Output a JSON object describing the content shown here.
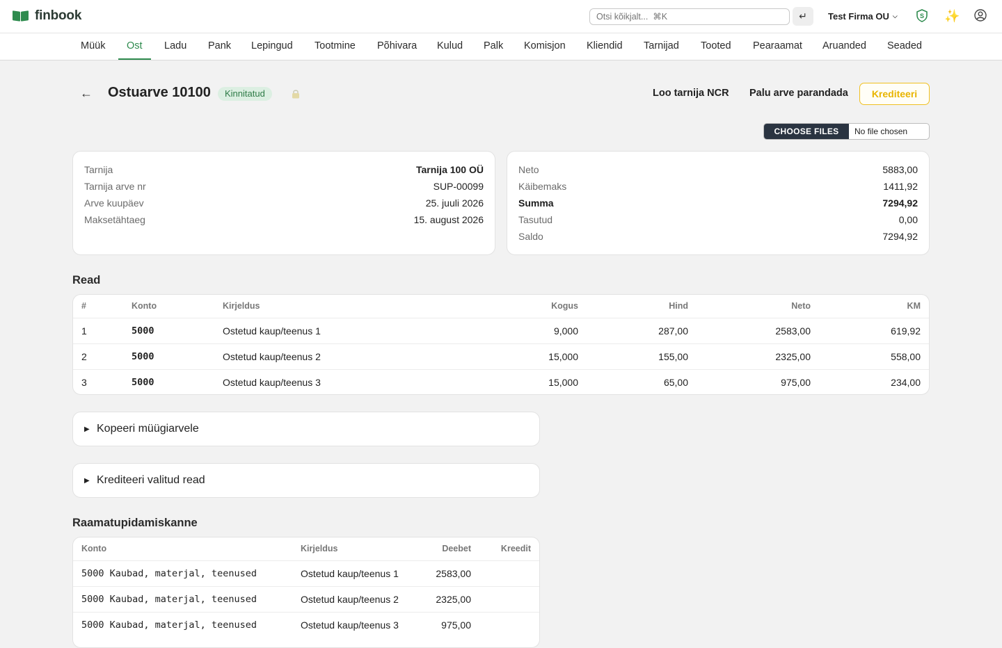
{
  "header": {
    "logo_text": "finbook",
    "search_placeholder": "Otsi kõikjalt...  ⌘K",
    "enter_glyph": "↵",
    "company": "Test Firma OU",
    "company_chevron": "⌵",
    "icons": [
      "shield-s-icon",
      "sparkle-icon",
      "user-circle-icon"
    ]
  },
  "nav": {
    "items": [
      "Müük",
      "Ost",
      "Ladu",
      "Pank",
      "Lepingud",
      "Tootmine",
      "Põhivara",
      "Kulud",
      "Palk",
      "Komisjon",
      "Kliendid",
      "Tarnijad",
      "Tooted",
      "Pearaamat",
      "Aruanded",
      "Seaded"
    ],
    "active": "Ost",
    "accent": "#2e8b4e"
  },
  "page": {
    "back_glyph": "←",
    "title": "Ostuarve 10100",
    "status": "Kinnitatud",
    "actions": {
      "ncr": "Loo tarnija NCR",
      "request_fix": "Palu arve parandada",
      "credit": "Krediteeri"
    },
    "file": {
      "button": "CHOOSE FILES",
      "status": "No file chosen"
    }
  },
  "invoice_info": [
    {
      "label": "Tarnija",
      "value": "Tarnija 100 OÜ"
    },
    {
      "label": "Tarnija arve nr",
      "value": "SUP-00099"
    },
    {
      "label": "Arve kuupäev",
      "value": "25. juuli 2026"
    },
    {
      "label": "Maksetähtaeg",
      "value": "15. august 2026"
    }
  ],
  "totals": [
    {
      "label": "Neto",
      "value": "5883,00"
    },
    {
      "label": "Käibemaks",
      "value": "1411,92"
    },
    {
      "label": "Summa",
      "value": "7294,92"
    },
    {
      "label": "Tasutud",
      "value": "0,00"
    },
    {
      "label": "Saldo",
      "value": "7294,92"
    }
  ],
  "lines": {
    "title": "Read",
    "headers": {
      "num": "#",
      "account": "Konto",
      "desc": "Kirjeldus",
      "qty": "Kogus",
      "price": "Hind",
      "net": "Neto",
      "vat": "KM"
    },
    "rows": [
      {
        "num": "1",
        "account": "5000",
        "desc": "Ostetud kaup/teenus 1",
        "qty": "9,000",
        "price": "287,00",
        "net": "2583,00",
        "vat": "619,92"
      },
      {
        "num": "2",
        "account": "5000",
        "desc": "Ostetud kaup/teenus 2",
        "qty": "15,000",
        "price": "155,00",
        "net": "2325,00",
        "vat": "558,00"
      },
      {
        "num": "3",
        "account": "5000",
        "desc": "Ostetud kaup/teenus 3",
        "qty": "15,000",
        "price": "65,00",
        "net": "975,00",
        "vat": "234,00"
      }
    ]
  },
  "accordions": {
    "copy": "Kopeeri müügiarvele",
    "credit_rows": "Krediteeri valitud read",
    "glyph": "▶"
  },
  "journal": {
    "title": "Raamatupidamiskanne",
    "headers": {
      "account": "Konto",
      "desc": "Kirjeldus",
      "debit": "Deebet",
      "credit": "Kreedit"
    },
    "rows": [
      {
        "account": "5000 Kaubad, materjal, teenused",
        "desc": "Ostetud kaup/teenus 1",
        "debit": "2583,00",
        "credit": ""
      },
      {
        "account": "5000 Kaubad, materjal, teenused",
        "desc": "Ostetud kaup/teenus 2",
        "debit": "2325,00",
        "credit": ""
      },
      {
        "account": "5000 Kaubad, materjal, teenused",
        "desc": "Ostetud kaup/teenus 3",
        "debit": "975,00",
        "credit": ""
      }
    ]
  }
}
